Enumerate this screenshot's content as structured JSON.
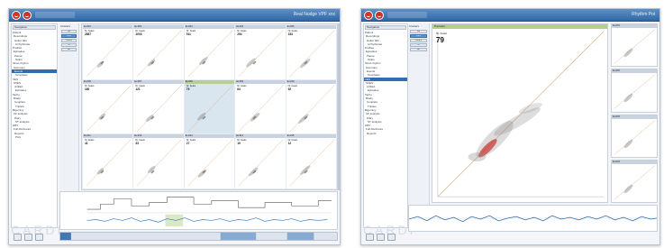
{
  "windowA": {
    "title": "Real Nudge VPF xxx",
    "sidebar": {
      "header": "Navigation",
      "items": [
        "Patient",
        "Recordings",
        "Holter 001",
        "Arrhythmias",
        "Profiles",
        "Episodes",
        "Pause",
        "Strips",
        "Sinus rhythm",
        "Summary",
        "Events",
        "Templates",
        "VES",
        "SVES",
        "Artifact",
        "Episodes",
        "Tachy",
        "Brady",
        "Couplets",
        "Triplets",
        "Bigeminy",
        "AF analysis",
        "Diary",
        "ST analysis",
        "HRV",
        "Full disclosure",
        "Reports",
        "Print"
      ],
      "selected_index": 10,
      "brand": "CARDI"
    },
    "midcol": {
      "label": "Clusters",
      "buttons": [
        "All",
        "VES",
        "SVES",
        "N",
        "Art"
      ],
      "active_index": 1
    },
    "cells": [
      {
        "head": "Ev.#01",
        "label": "Nr. beats",
        "value": "2887"
      },
      {
        "head": "Ev.#02",
        "label": "Nr. beats",
        "value": "1003"
      },
      {
        "head": "Ev.#03",
        "label": "Nr. beats",
        "value": "511"
      },
      {
        "head": "Ev.#04",
        "label": "Nr. beats",
        "value": "294"
      },
      {
        "head": "Ev.#05",
        "label": "Nr. beats",
        "value": "233"
      },
      {
        "head": "Ev.#06",
        "label": "Nr. beats",
        "value": "160"
      },
      {
        "head": "Ev.#07",
        "label": "Nr. beats",
        "value": "121"
      },
      {
        "head": "Ev.#08",
        "label": "Nr. beats",
        "value": "79"
      },
      {
        "head": "Ev.#09",
        "label": "Nr. beats",
        "value": "64"
      },
      {
        "head": "Ev.#10",
        "label": "Nr. beats",
        "value": "52"
      },
      {
        "head": "Ev.#11",
        "label": "Nr. beats",
        "value": "41"
      },
      {
        "head": "Ev.#12",
        "label": "Nr. beats",
        "value": "33"
      },
      {
        "head": "Ev.#13",
        "label": "Nr. beats",
        "value": "27"
      },
      {
        "head": "Ev.#14",
        "label": "Nr. beats",
        "value": "19"
      },
      {
        "head": "Ev.#15",
        "label": "Nr. beats",
        "value": "12"
      }
    ],
    "highlighted_cell": 7
  },
  "windowB": {
    "title": "Rhythm Poi",
    "sidebar": {
      "header": "Navigation",
      "items": [
        "Patient",
        "Recordings",
        "Holter 001",
        "Arrhythmias",
        "Profiles",
        "Episodes",
        "Pause",
        "Strips",
        "Sinus rhythm",
        "Summary",
        "Events",
        "Templates",
        "VES",
        "SVES",
        "Artifact",
        "Episodes",
        "Tachy",
        "Brady",
        "Couplets",
        "Triplets",
        "Bigeminy",
        "AF analysis",
        "Diary",
        "ST analysis",
        "HRV",
        "Full disclosure",
        "Reports"
      ],
      "selected_index": 12,
      "brand": "CARDI"
    },
    "midcol": {
      "label": "Clusters",
      "buttons": [
        "All",
        "VES",
        "SVES",
        "N",
        "Art"
      ],
      "active_index": 1
    },
    "big_plot": {
      "head": "Poincaré",
      "label": "Nr. beats",
      "value": "79"
    },
    "thumbs": [
      {
        "head": "Ev.#01"
      },
      {
        "head": "Ev.#02"
      },
      {
        "head": "Ev.#03"
      },
      {
        "head": "Ev.#04"
      }
    ]
  },
  "colors": {
    "titlebar": "#2f68a8",
    "accent": "#5d93cf",
    "highlight_green": "#b9cf8f",
    "scatter_red": "#c8322c",
    "diagonal": "#e0a36a"
  }
}
